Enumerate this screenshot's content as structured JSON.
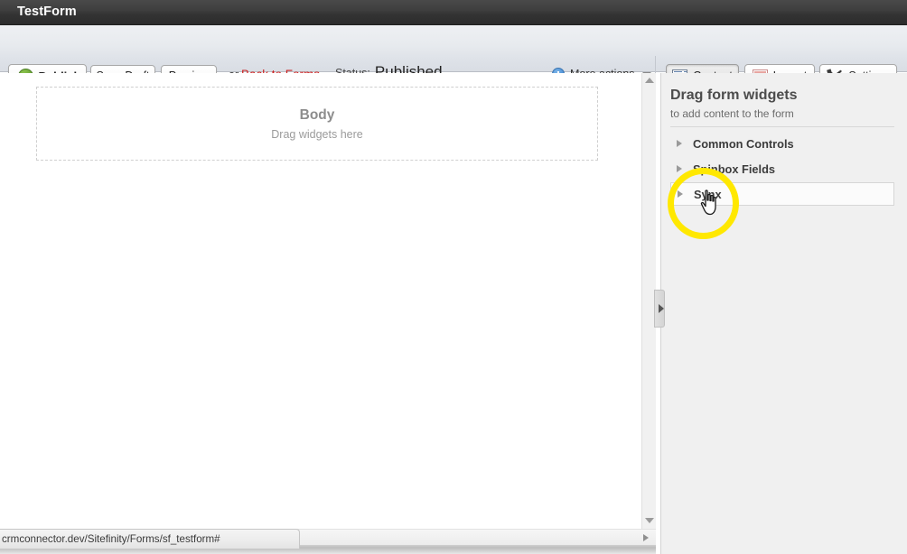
{
  "titlebar": {
    "title": "TestForm"
  },
  "toolbar": {
    "publish_label": "Publish",
    "publish_icon": "check-circle-icon",
    "save_draft_label": "Save Draft",
    "preview_label": "Preview",
    "or_text": "or",
    "back_to_forms_label": "Back to Forms",
    "back_to_forms_color": "#cc2222",
    "status_label": "Status:",
    "status_value": "Published",
    "more_actions_label": "More actions",
    "more_actions_icon": "plus-circle-icon",
    "more_actions_chevron": "chevron-down-icon",
    "tabs": [
      {
        "label": "Content",
        "icon": "content-lines-icon",
        "selected": true
      },
      {
        "label": "Layout",
        "icon": "layout-grid-icon",
        "selected": false
      },
      {
        "label": "Settings",
        "icon": "tools-icon",
        "selected": false
      }
    ]
  },
  "canvas": {
    "dropzone_title": "Body",
    "dropzone_sub": "Drag widgets here"
  },
  "sidebar": {
    "heading": "Drag form widgets",
    "subheading": "to add content to the form",
    "groups": [
      {
        "label": "Common Controls",
        "expanded": false,
        "hovered": false
      },
      {
        "label": "Spinbox Fields",
        "expanded": false,
        "hovered": false
      },
      {
        "label": "Synx",
        "expanded": false,
        "hovered": true
      }
    ]
  },
  "scrollbars": {
    "vertical_up_icon": "triangle-up-icon",
    "vertical_down_icon": "triangle-down-icon",
    "horizontal_right_icon": "triangle-right-icon",
    "panel_collapse_icon": "triangle-right-icon"
  },
  "status_bar": {
    "url": "crmconnector.dev/Sitefinity/Forms/sf_testform#"
  },
  "annotation": {
    "highlight_color": "#ffe800",
    "cursor_icon": "hand-pointer-cursor"
  }
}
